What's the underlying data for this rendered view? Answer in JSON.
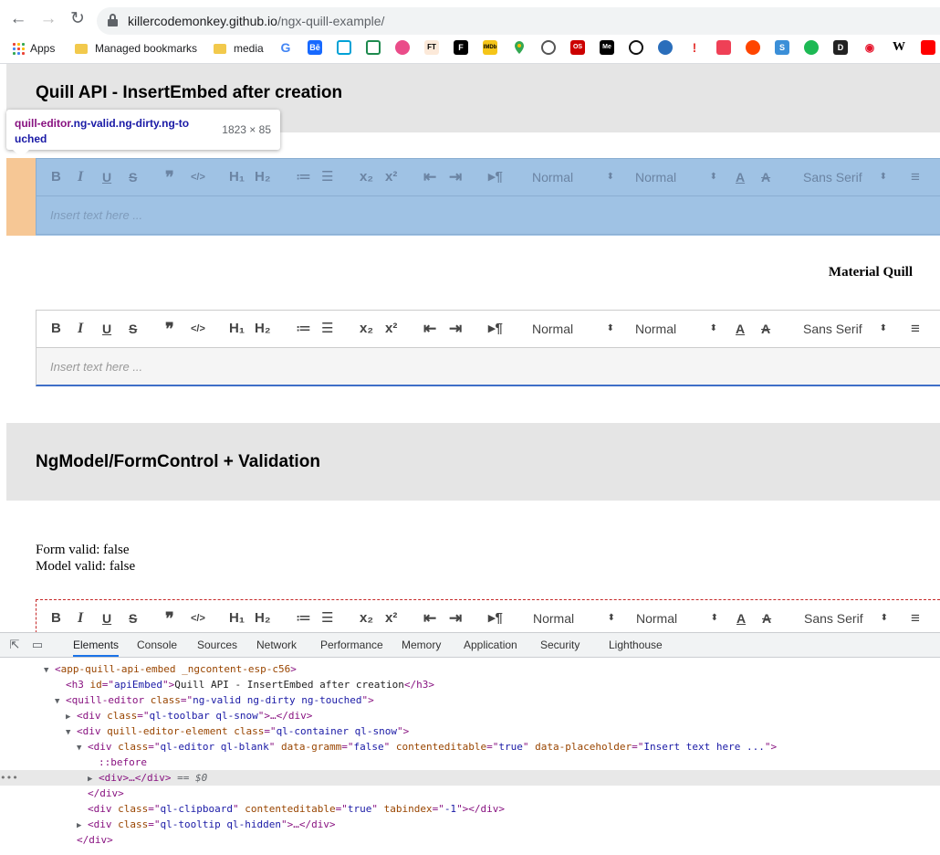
{
  "browser": {
    "url_host": "killercodemonkey.github.io",
    "url_path": "/ngx-quill-example/",
    "bookmarks": [
      {
        "label": "Apps"
      },
      {
        "label": "Managed bookmarks"
      },
      {
        "label": "media"
      }
    ],
    "favicons": [
      "G",
      "Bē",
      "bili",
      "wc",
      "dribbble",
      "FT",
      "F",
      "IMDb",
      "maps",
      "chat",
      "OS",
      "Me",
      "co",
      "ow",
      "ti",
      "pocket",
      "reddit",
      "S",
      "spotify",
      "D",
      "weibo",
      "W",
      "yt"
    ]
  },
  "inspect_tooltip": {
    "selector_tag": "quill-editor",
    "selector_classes_line1": ".ng-valid.ng-dirty.ng-to",
    "selector_classes_line2": "uched",
    "size": "1823 × 85"
  },
  "sections": {
    "api_title": "Quill API - InsertEmbed after creation",
    "material_title": "Material Quill",
    "ngmodel_title": "NgModel/FormControl + Validation",
    "form_valid": "Form valid: false",
    "model_valid": "Model valid: false"
  },
  "toolbar": {
    "bold": "B",
    "italic": "I",
    "underline": "U",
    "strike": "S",
    "blockquote": "❞",
    "code": "</>",
    "h1": "H₁",
    "h2": "H₂",
    "ordered_list": "≔",
    "bullet_list": "☰",
    "subscript": "x₂",
    "superscript": "x²",
    "outdent": "⇤",
    "indent": "⇥",
    "direction": "▸¶",
    "size_select": "Normal",
    "header_select": "Normal",
    "font_select": "Sans Serif",
    "caret": "⬍",
    "align": "≡"
  },
  "editor": {
    "placeholder": "Insert text here ..."
  },
  "devtools": {
    "tabs": [
      "Elements",
      "Console",
      "Sources",
      "Network",
      "Performance",
      "Memory",
      "Application",
      "Security",
      "Lighthouse"
    ],
    "active_tab": "Elements",
    "lines": [
      {
        "text": "app-quill-api-embed _ngcontent-esp-c56"
      },
      {
        "text": "Quill API - InsertEmbed after creation"
      },
      {
        "text": "ng-valid ng-dirty ng-touched"
      },
      {
        "text": "ql-toolbar ql-snow"
      },
      {
        "text": "ql-container ql-snow"
      },
      {
        "text": "ql-editor ql-blank"
      },
      {
        "text": "false"
      },
      {
        "text": "true"
      },
      {
        "text": "Insert text here ..."
      },
      {
        "text": "::before"
      },
      {
        "text": "== $0"
      },
      {
        "text": "ql-clipboard"
      },
      {
        "text": "-1"
      },
      {
        "text": "ql-tooltip ql-hidden"
      }
    ]
  },
  "colors": {
    "highlight_content": "#9fc2e4",
    "highlight_margin": "#f6c795",
    "banner": "#e5e5e5",
    "invalid_border": "#c62828",
    "material_underline": "#3f6fc8"
  }
}
